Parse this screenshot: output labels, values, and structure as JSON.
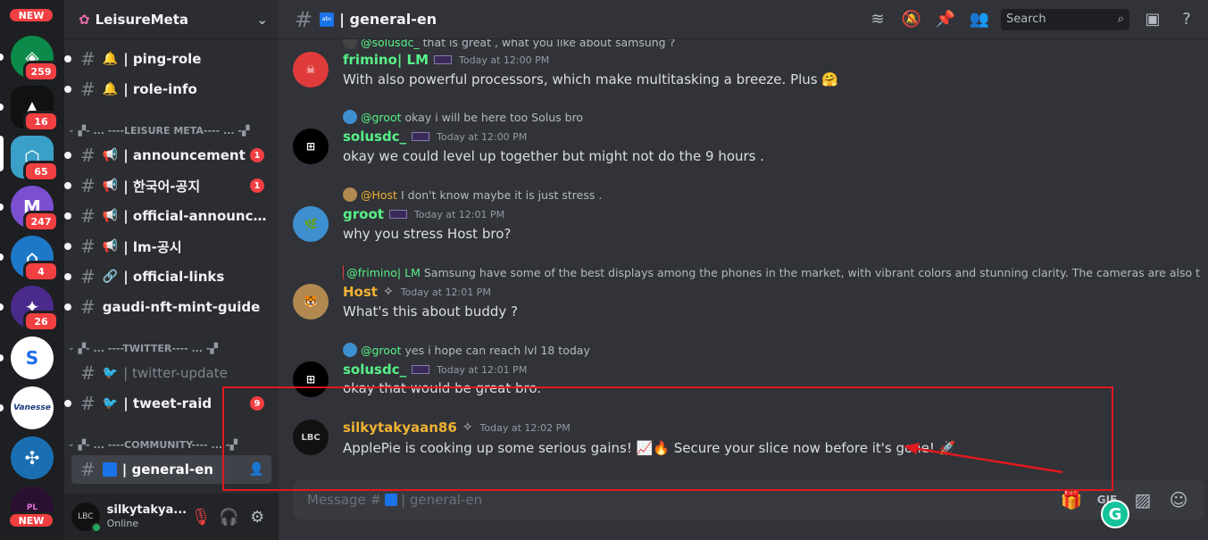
{
  "servers": [
    {
      "badge": "",
      "new_tag": "NEW",
      "color": "#f0b232"
    },
    {
      "badge": "259",
      "color": "#0b8a4a"
    },
    {
      "badge": "16",
      "color": "#111111"
    },
    {
      "badge": "65",
      "color": "#3ba0c8"
    },
    {
      "badge": "247",
      "color": "#7a4fd0"
    },
    {
      "badge": "4",
      "color": "#1e78c8"
    },
    {
      "badge": "26",
      "color": "#4a2a8a"
    },
    {
      "badge": "",
      "color": "#1e6ee8"
    },
    {
      "badge": "",
      "color": "#ffffff",
      "label": "Vanesse"
    },
    {
      "badge": "",
      "color": "#1a6fb3"
    },
    {
      "badge": "",
      "new_tag": "NEW",
      "color": "#2a1030"
    }
  ],
  "guild": {
    "name": "LeisureMeta"
  },
  "channels": [
    {
      "emoji": "🔔",
      "label": "| ping-role",
      "state": "normal"
    },
    {
      "emoji": "🔔",
      "label": "| role-info",
      "state": "normal"
    },
    {
      "emoji": "📢",
      "label": "| announcement",
      "badge": "1",
      "state": "normal"
    },
    {
      "emoji": "📢",
      "label": "| 한국어-공지",
      "badge": "1",
      "state": "normal"
    },
    {
      "emoji": "📢",
      "label": "| official-announce...",
      "state": "normal"
    },
    {
      "emoji": "📢",
      "label": "| lm-공시",
      "state": "normal"
    },
    {
      "emoji": "🔗",
      "label": "| official-links",
      "state": "normal"
    },
    {
      "emoji": "",
      "label": "gaudi-nft-mint-guide",
      "state": "normal"
    },
    {
      "emoji": "🐦",
      "label": "| twitter-update",
      "state": "muted"
    },
    {
      "emoji": "🐦",
      "label": "| tweet-raid",
      "badge": "9",
      "state": "normal"
    },
    {
      "emoji": "",
      "label": "| general-en",
      "state": "active"
    }
  ],
  "categories": [
    {
      "label": "▞- ... ----LEISURE META---- ... -▞"
    },
    {
      "label": "▞- ... ----TWITTER---- ... -▞"
    },
    {
      "label": "▞- ... ----COMMUNITY---- ... -▞"
    }
  ],
  "user": {
    "name": "silkytakya...",
    "status": "Online"
  },
  "topbar": {
    "channel": "| general-en",
    "search_placeholder": "Search"
  },
  "messages": [
    {
      "reply_name": "@solusdc_",
      "reply_text": "that is great , what you like about samsung ?",
      "name": "frimino| LM",
      "name_color": "#57f287",
      "time": "Today at 12:00 PM",
      "body": "With also powerful processors, which make multitasking a breeze. Plus 🤗",
      "avatar_color": "#e03b3b"
    },
    {
      "reply_name": "@groot",
      "reply_text": "okay i will be here too Solus bro",
      "name": "solusdc_",
      "name_color": "#57f287",
      "time": "Today at 12:00 PM",
      "body": "okay we could level up together but might not do the 9 hours .",
      "avatar_color": "#000000"
    },
    {
      "reply_name": "@Host",
      "reply_text": "I don't know maybe it is just stress .",
      "name": "groot",
      "name_color": "#57f287",
      "time": "Today at 12:01 PM",
      "body": "why you stress Host bro?",
      "avatar_color": "#3e8fd0"
    },
    {
      "reply_name": "@frimino| LM",
      "reply_text": "Samsung have some of the best displays among the phones in the market, with vibrant colors and stunning clarity. The cameras are also t",
      "name": "Host",
      "name_color": "#f0b232",
      "time": "Today at 12:01 PM",
      "body": "What's this about buddy ?",
      "avatar_color": "#b08850"
    },
    {
      "reply_name": "@groot",
      "reply_text": "yes i hope can reach lvl 18 today",
      "name": "solusdc_",
      "name_color": "#57f287",
      "time": "Today at 12:01 PM",
      "body": "okay that would be great bro.",
      "avatar_color": "#000000"
    },
    {
      "reply_name": "",
      "reply_text": "",
      "name": "silkytakyaan86",
      "name_color": "#f0b232",
      "time": "Today at 12:02 PM",
      "body": "ApplePie is cooking up some serious gains! 📈🔥 Secure your slice now before it's gone! 🚀",
      "avatar_color": "#111111"
    }
  ],
  "composer": {
    "placeholder_prefix": "Message #",
    "placeholder_channel": "| general-en"
  },
  "colors": {
    "highlight": "#e0191e",
    "grammarly": "#15c39a"
  }
}
